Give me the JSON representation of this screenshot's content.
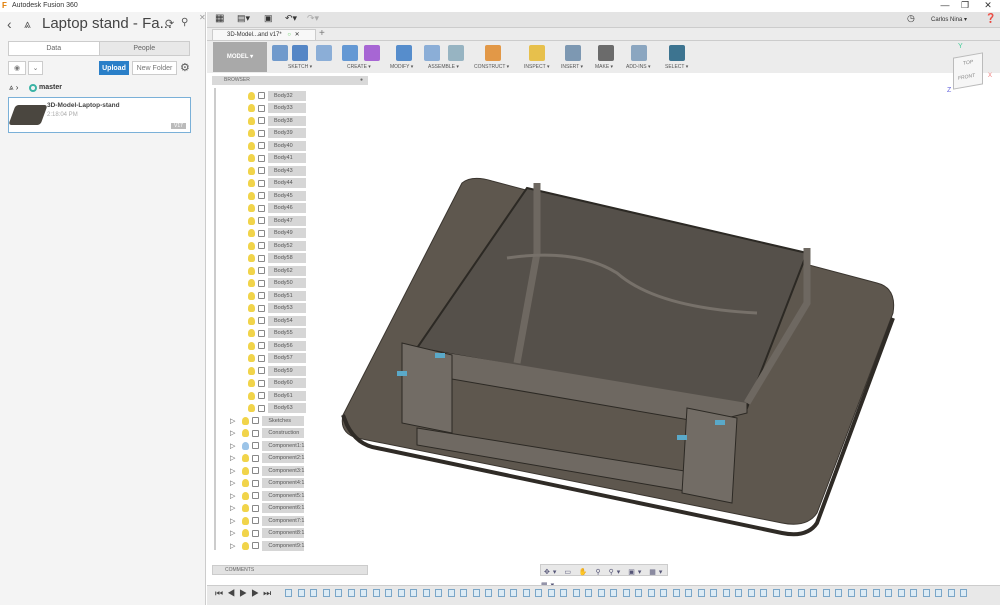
{
  "window": {
    "title": "Autodesk Fusion 360",
    "controls": [
      "—",
      "❐",
      "✕"
    ]
  },
  "left_panel": {
    "project_title": "Laptop stand - Fa...",
    "tabs": [
      "Data",
      "People"
    ],
    "upload_label": "Upload",
    "new_folder_label": "New Folder",
    "breadcrumb": "master",
    "file": {
      "name": "3D-Model-Laptop-stand",
      "time": "2:18:04 PM",
      "version": "V17"
    }
  },
  "header": {
    "user": "Carlos Nina ▾"
  },
  "document_tab": {
    "label": "3D-Model...and v17*"
  },
  "toolbar": {
    "workspace": "MODEL ▾",
    "groups": [
      "SKETCH ▾",
      "CREATE ▾",
      "MODIFY ▾",
      "ASSEMBLE ▾",
      "CONSTRUCT ▾",
      "INSPECT ▾",
      "INSERT ▾",
      "MAKE ▾",
      "ADD-INS ▾",
      "SELECT ▾"
    ]
  },
  "browser": {
    "title": "BROWSER",
    "bodies": [
      "Body32",
      "Body33",
      "Body38",
      "Body39",
      "Body40",
      "Body41",
      "Body43",
      "Body44",
      "Body45",
      "Body46",
      "Body47",
      "Body49",
      "Body52",
      "Body58",
      "Body62",
      "Body50",
      "Body51",
      "Body53",
      "Body54",
      "Body55",
      "Body56",
      "Body57",
      "Body59",
      "Body60",
      "Body61",
      "Body63"
    ],
    "folders": [
      "Sketches",
      "Construction",
      "Component1:1",
      "Component2:1",
      "Component3:1",
      "Component4:1",
      "Component5:1",
      "Component6:1",
      "Component7:1",
      "Component8:1",
      "Component9:1"
    ]
  },
  "comments": {
    "title": "COMMENTS"
  },
  "viewcube": {
    "top": "TOP",
    "front": "FRONT",
    "axes": [
      "Y",
      "X",
      "Z"
    ]
  },
  "colors": {
    "accent": "#2a7fc8",
    "model": "#5e574e",
    "bulb": "#f1d44a"
  }
}
